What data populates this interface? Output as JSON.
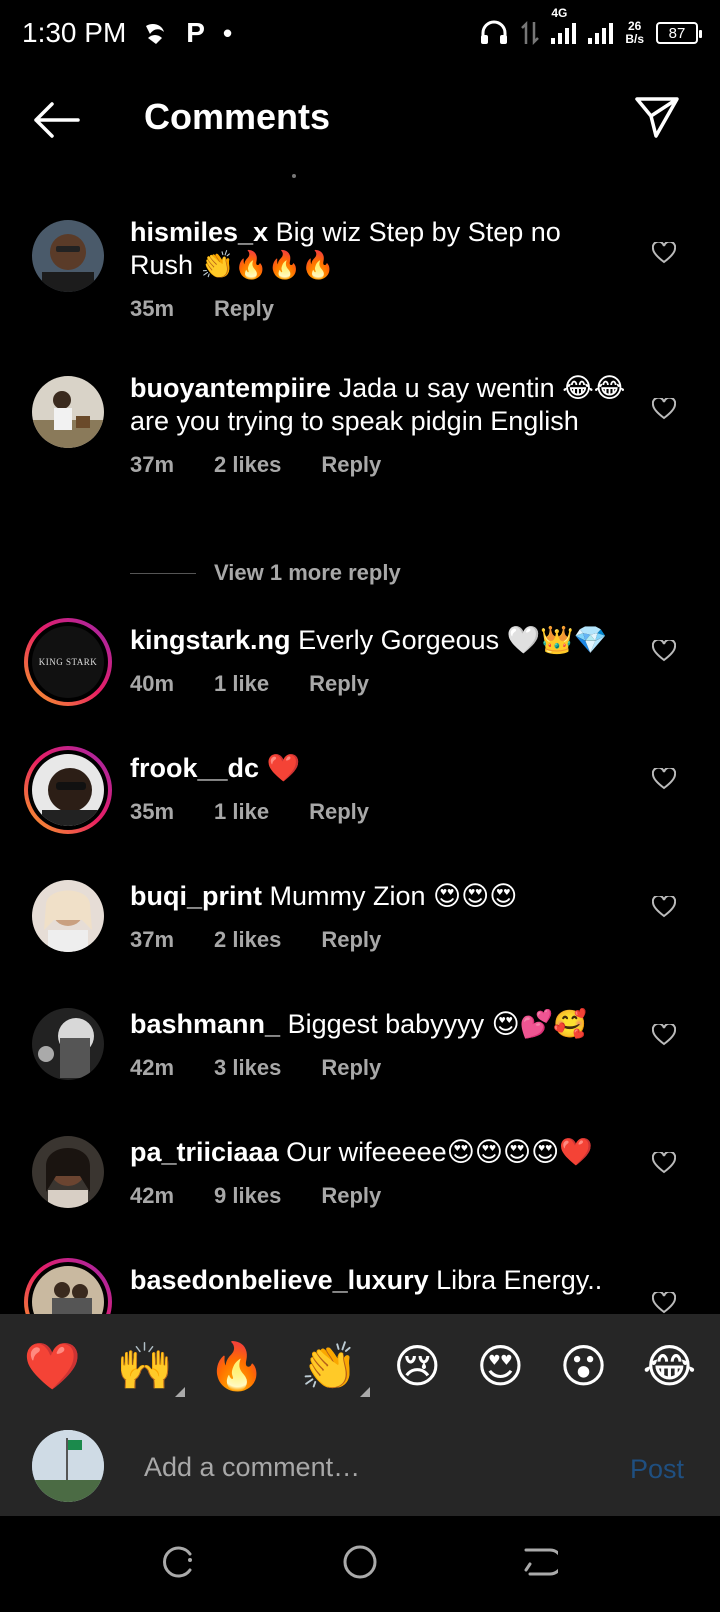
{
  "status_bar": {
    "time": "1:30 PM",
    "icons": [
      "notification-icon",
      "p-app-icon",
      "dot"
    ],
    "network": "4G",
    "net_speed_value": "26",
    "net_speed_unit": "B/s",
    "battery": "87"
  },
  "header": {
    "title": "Comments"
  },
  "comments": [
    {
      "user": "hismiles_x",
      "text": "Big wiz Step by Step no Rush 👏🔥🔥🔥",
      "time": "35m",
      "likes": "",
      "reply": "Reply"
    },
    {
      "user": "buoyantempiire",
      "text": "Jada u say wentin 😂😂 are you trying to speak pidgin English",
      "time": "37m",
      "likes": "2 likes",
      "reply": "Reply"
    },
    {
      "user": "kingstark.ng",
      "text": "Everly Gorgeous 🤍👑💎",
      "time": "40m",
      "likes": "1 like",
      "reply": "Reply"
    },
    {
      "user": "frook__dc",
      "text": "❤️",
      "time": "35m",
      "likes": "1 like",
      "reply": "Reply"
    },
    {
      "user": "buqi_print",
      "text": "Mummy Zion 😍😍😍",
      "time": "37m",
      "likes": "2 likes",
      "reply": "Reply"
    },
    {
      "user": "bashmann_",
      "text": "Biggest babyyyy 😍💕🥰",
      "time": "42m",
      "likes": "3 likes",
      "reply": "Reply"
    },
    {
      "user": "pa_triiciaaa",
      "text": "Our wifeeeee😍😍😍😍❤️",
      "time": "42m",
      "likes": "9 likes",
      "reply": "Reply"
    },
    {
      "user": "basedonbelieve_luxury",
      "text": "Libra Energy..",
      "time": "",
      "likes": "",
      "reply": ""
    }
  ],
  "view_more": "View 1 more reply",
  "emoji_bar": [
    "❤️",
    "🙌",
    "🔥",
    "👏",
    "😢",
    "😍",
    "😮",
    "😂"
  ],
  "composer": {
    "placeholder": "Add a comment…",
    "post_label": "Post"
  },
  "avatar_logo_text": "KING STARK"
}
